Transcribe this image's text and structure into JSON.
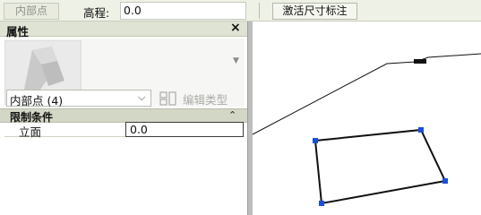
{
  "options_bar": {
    "mode_button": "内部点",
    "elevation_label": "高程:",
    "elevation_value": "0.0",
    "activate_dimensions_button": "激活尺寸标注"
  },
  "properties": {
    "title": "属性",
    "close_icon": "close-icon",
    "type_selector": "内部点 (4)",
    "edit_type_label": "编辑类型",
    "category_label": "限制条件",
    "rows": [
      {
        "name": "立面",
        "value": "0.0"
      }
    ]
  },
  "canvas": {
    "polyline_color": "#000000",
    "point_color": "#1b4fd8"
  }
}
